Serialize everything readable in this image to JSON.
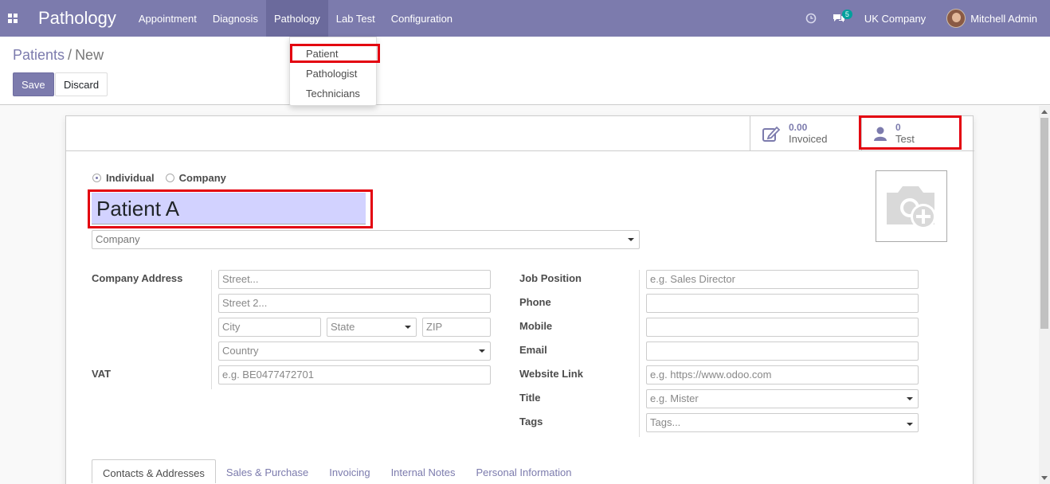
{
  "navbar": {
    "brand": "Pathology",
    "menu": [
      "Appointment",
      "Diagnosis",
      "Pathology",
      "Lab Test",
      "Configuration"
    ],
    "message_count": "5",
    "company": "UK Company",
    "user": "Mitchell Admin"
  },
  "dropdown": {
    "items": [
      "Patient",
      "Pathologist",
      "Technicians"
    ]
  },
  "control": {
    "breadcrumb_parent": "Patients",
    "breadcrumb_sep": "/",
    "breadcrumb_current": "New",
    "save": "Save",
    "discard": "Discard"
  },
  "stats": {
    "invoiced_value": "0.00",
    "invoiced_label": "Invoiced",
    "test_value": "0",
    "test_label": "Test"
  },
  "form": {
    "type_individual": "Individual",
    "type_company": "Company",
    "name": "Patient A",
    "company_placeholder": "Company",
    "company_address_label": "Company Address",
    "street": "Street...",
    "street2": "Street 2...",
    "city": "City",
    "state": "State",
    "zip": "ZIP",
    "country": "Country",
    "vat_label": "VAT",
    "vat_placeholder": "e.g. BE0477472701",
    "job_label": "Job Position",
    "job_placeholder": "e.g. Sales Director",
    "phone_label": "Phone",
    "mobile_label": "Mobile",
    "email_label": "Email",
    "website_label": "Website Link",
    "website_placeholder": "e.g. https://www.odoo.com",
    "title_label": "Title",
    "title_placeholder": "e.g. Mister",
    "tags_label": "Tags",
    "tags_placeholder": "Tags..."
  },
  "tabs": [
    "Contacts & Addresses",
    "Sales & Purchase",
    "Invoicing",
    "Internal Notes",
    "Personal Information"
  ],
  "colors": {
    "navbar": "#7c7bad",
    "highlight": "#e3000f",
    "name_bg": "#d2d2ff"
  }
}
